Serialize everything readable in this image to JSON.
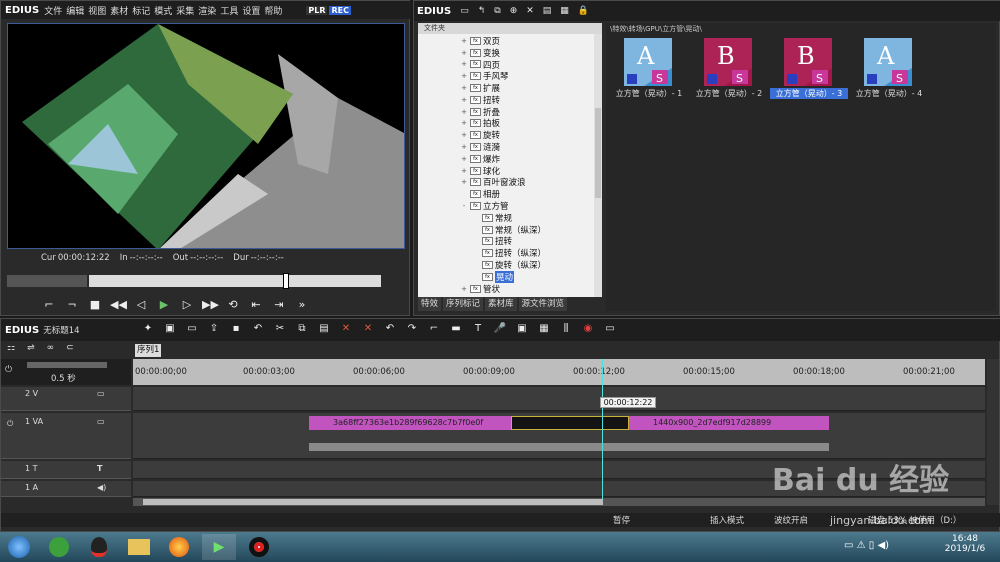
{
  "player": {
    "app": "EDIUS",
    "menu": [
      "文件",
      "编辑",
      "视图",
      "素材",
      "标记",
      "模式",
      "采集",
      "渲染",
      "工具",
      "设置",
      "帮助"
    ],
    "plr": "PLR",
    "rec": "REC",
    "cur_label": "Cur",
    "cur_value": "00:00:12:22",
    "in_label": "In",
    "in_value": "--:--:--:--",
    "out_label": "Out",
    "out_value": "--:--:--:--",
    "dur_label": "Dur",
    "dur_value": "--:--:--:--"
  },
  "bin": {
    "app": "EDIUS",
    "folder_header": "文件夹",
    "path": "\\特效\\转场\\GPU\\立方管\\晃动\\",
    "tree": [
      {
        "label": "双页",
        "expand": "+"
      },
      {
        "label": "变换",
        "expand": "+"
      },
      {
        "label": "四页",
        "expand": "+"
      },
      {
        "label": "手风琴",
        "expand": "+"
      },
      {
        "label": "扩展",
        "expand": "+"
      },
      {
        "label": "扭转",
        "expand": "+"
      },
      {
        "label": "折叠",
        "expand": "+"
      },
      {
        "label": "拍板",
        "expand": "+"
      },
      {
        "label": "旋转",
        "expand": "+"
      },
      {
        "label": "涟漪",
        "expand": "+"
      },
      {
        "label": "爆炸",
        "expand": "+"
      },
      {
        "label": "球化",
        "expand": "+"
      },
      {
        "label": "百叶窗波浪",
        "expand": "+"
      },
      {
        "label": "相册",
        "expand": ""
      },
      {
        "label": "立方管",
        "expand": "-"
      },
      {
        "label": "常规",
        "expand": ""
      },
      {
        "label": "常规（纵深）",
        "expand": ""
      },
      {
        "label": "扭转",
        "expand": ""
      },
      {
        "label": "扭转（纵深）",
        "expand": ""
      },
      {
        "label": "旋转（纵深）",
        "expand": ""
      },
      {
        "label": "晃动",
        "expand": "",
        "selected": true
      },
      {
        "label": "管状",
        "expand": "+"
      }
    ],
    "tabs": [
      "特效",
      "序列标记",
      "素材库",
      "源文件浏览"
    ],
    "clips": [
      {
        "label": "立方管（晃动）- 1",
        "letter": "A"
      },
      {
        "label": "立方管（晃动）- 2",
        "letter": "B"
      },
      {
        "label": "立方管（晃动）- 3",
        "letter": "B",
        "selected": true
      },
      {
        "label": "立方管（晃动）- 4",
        "letter": "A"
      }
    ]
  },
  "timeline": {
    "app": "EDIUS",
    "project": "无标题14",
    "sequence_tab": "序列1",
    "scale": "0.5 秒",
    "ruler": [
      "00:00:00;00",
      "00:00:03;00",
      "00:00:06;00",
      "00:00:09;00",
      "00:00:12;00",
      "00:00:15;00",
      "00:00:18;00",
      "00:00:21;00"
    ],
    "playhead_tooltip": "00:00:12:22",
    "playhead_fraction": 0.55,
    "tracks": [
      {
        "name": "2 V"
      },
      {
        "name": "1 VA"
      },
      {
        "name": "1 T"
      },
      {
        "name": "1 A"
      }
    ],
    "clip1": "3a68ff27363e1b289f69628c7b7f0e0f",
    "clip2": "1440x900_2d7edf917d28899",
    "status": [
      "暂停",
      "插入模式",
      "波纹开启",
      "磁盘:53% 被使用（D:）"
    ]
  },
  "taskbar": {
    "time": "16:48",
    "date": "2019/1/6"
  },
  "watermark": {
    "brand": "Bai du 经验",
    "url": "jingyan.baidu.com"
  },
  "colors": {
    "accent": "#3a6fd8",
    "clip": "#c254c0",
    "bar": "#1e1e1e"
  }
}
